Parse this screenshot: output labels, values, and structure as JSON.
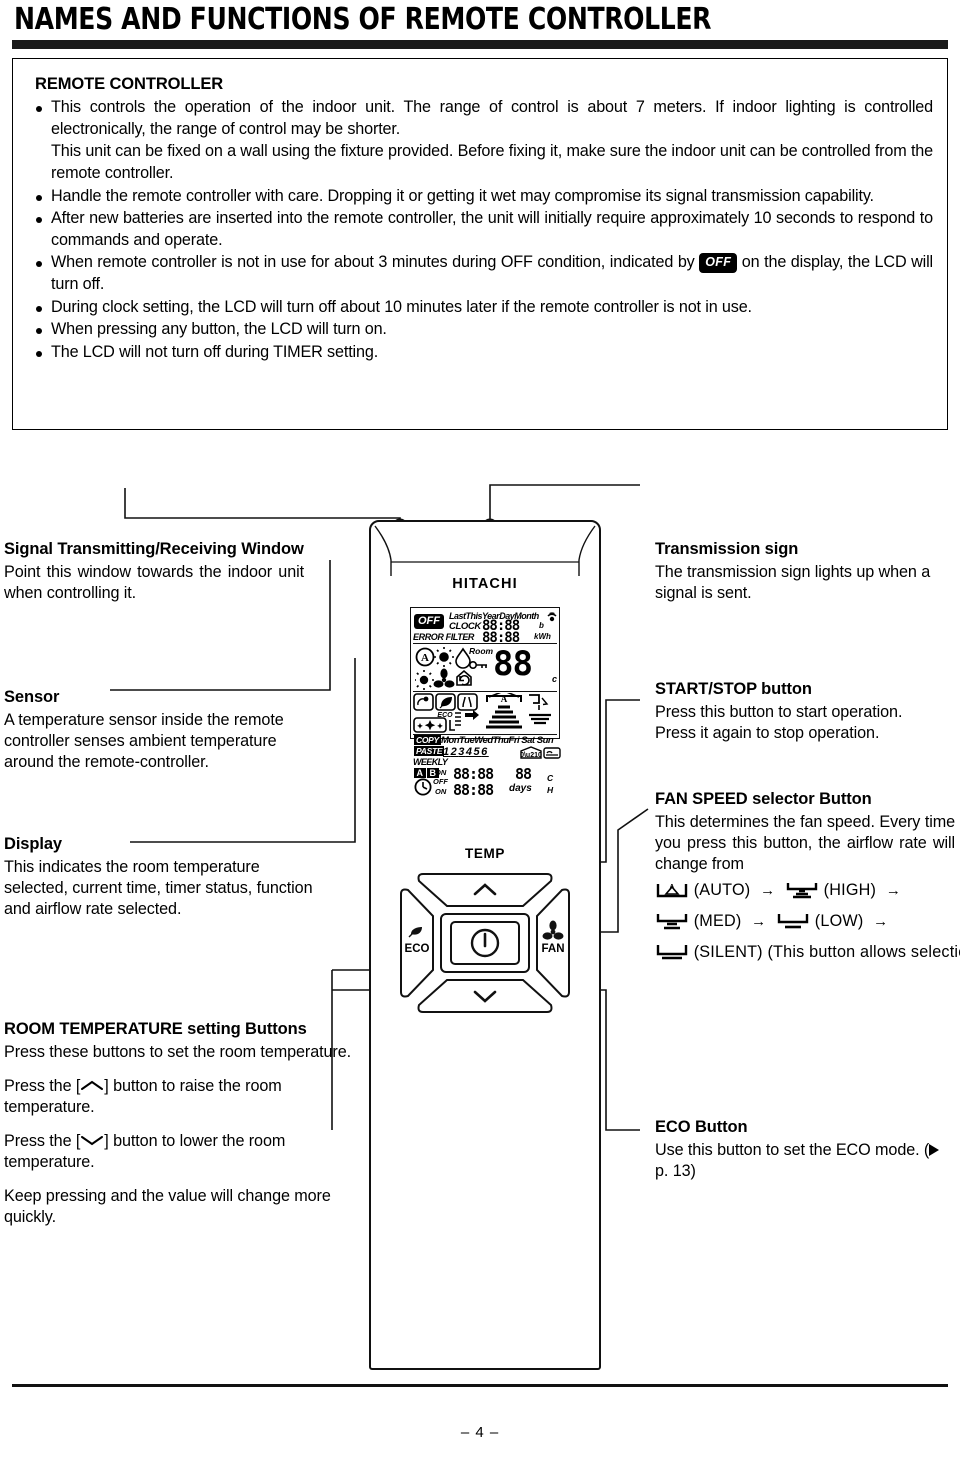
{
  "header": {
    "title": "NAMES AND FUNCTIONS OF REMOTE CONTROLLER"
  },
  "intro": {
    "heading": "REMOTE CONTROLLER",
    "bullets": [
      "This controls the operation of the indoor unit. The range of control is about 7 meters. If indoor lighting is controlled electronically, the range of control may be shorter.",
      "This unit can be fixed on a wall using the fixture provided. Before fixing it, make sure the indoor unit can be controlled from the remote controller.",
      "Handle the remote controller with care. Dropping it or getting it wet may compromise its signal transmission capability.",
      "After new batteries are inserted into the remote controller, the unit will initially require approximately 10 seconds to respond to commands and operate.",
      "During clock setting, the LCD will turn off about 10 minutes later if the remote controller is not in use.",
      "When pressing any button, the LCD will turn on.",
      "The LCD will not turn off during TIMER setting."
    ],
    "off_bullet": {
      "part1": "When remote controller is not in use for about 3 minutes during OFF condition, indicated by",
      "chip": "OFF",
      "part2": "on the display, the LCD will turn off."
    }
  },
  "callouts": {
    "signal": {
      "title": "Signal Transmitting/Receiving Window",
      "body": "Point this window towards the indoor unit when controlling it."
    },
    "sensor": {
      "title": "Sensor",
      "body": "A temperature sensor inside the remote controller senses ambient temperature around the remote-controller."
    },
    "display": {
      "title": "Display",
      "body": "This indicates the room temperature selected, current time, timer status, function and airflow rate selected."
    },
    "room_temperature": {
      "title": "ROOM TEMPERATURE setting Buttons",
      "body1": "Press these buttons to set the room temperature.",
      "body2_pre": "Press the [",
      "body2_post": "] button to raise the room temperature.",
      "body3_pre": "Press the [",
      "body3_post": "] button to lower the room temperature.",
      "body4": "Keep pressing and the value will change more quickly."
    },
    "transmission": {
      "title": "Transmission sign",
      "body": "The transmission sign lights up when a signal is sent."
    },
    "start_stop": {
      "title": "START/STOP button",
      "body": "Press this button to start operation. Press it again to stop operation."
    },
    "fan_speed": {
      "title": "FAN SPEED selector Button",
      "body1": "This determines the fan speed. Every time you press this button, the airflow rate will change from",
      "modes": [
        {
          "label": "(AUTO)",
          "icon": "fan-auto-icon"
        },
        {
          "label": "(HIGH)",
          "icon": "fan-high-icon"
        },
        {
          "label": "(MED)",
          "icon": "fan-med-icon"
        },
        {
          "label": "(LOW)",
          "icon": "fan-low-icon"
        },
        {
          "label": "(SILENT)",
          "icon": "fan-silent-icon"
        }
      ],
      "arrow": "→",
      "body2": "(This button allows selection of optimal or preferred fan speed for each operation mode)."
    },
    "eco": {
      "title": "ECO Button",
      "body_pre": "Use this button to set the ECO mode. (",
      "page_ref": "p. 13",
      "body_post": ")"
    }
  },
  "remote": {
    "brand": "HITACHI",
    "temp_label": "TEMP",
    "eco_label": "ECO",
    "fan_label": "FAN",
    "lcd": {
      "off_badge": "OFF",
      "error_filter": "ERROR FILTER",
      "period_labels": "LastThisYearDayMonth",
      "clock_label": "CLOCK",
      "digits_row1": "88:88",
      "digits_row2": "88:88",
      "unit_b": "b",
      "unit_kwh": "kWh",
      "room_label": "Room",
      "big_temp": "88",
      "deg_c": "c",
      "eco_label": "ECO",
      "auto_mark": "A",
      "copy_label": "COPY",
      "paste_label": "PASTE",
      "weekly_label": "WEEKLY",
      "ab_a": "A",
      "ab_b": "B",
      "weekdays": "MonTueWedThuFri Sat Sun",
      "day_numbers": [
        "1",
        "2",
        "3",
        "4",
        "5",
        "6"
      ],
      "temp_chip": "10°c",
      "timer_on1": "ON",
      "timer_off": "OFF",
      "timer_on2": "ON",
      "timer_digits1": "88:88",
      "timer_digits2": "88:88",
      "timer_temp": "88",
      "days_label": "days",
      "mode_c": "C",
      "mode_h": "H"
    }
  },
  "footer": {
    "page_number": "– 4 –"
  }
}
